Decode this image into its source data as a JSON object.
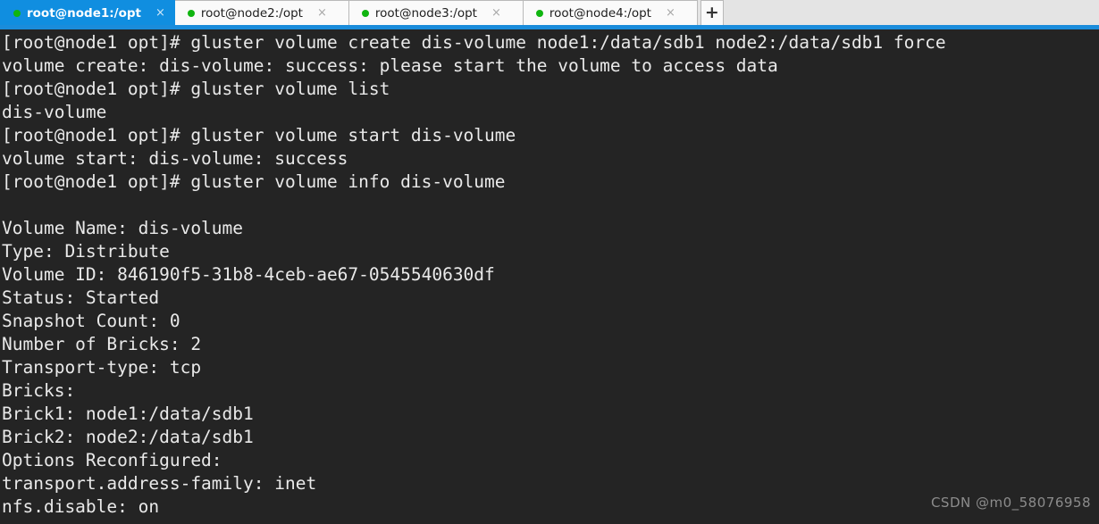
{
  "window": {
    "app": "terminal-emulator",
    "accent_color": "#108ee0",
    "tabbar_bg": "#e4e4e4",
    "terminal_bg": "#242424",
    "terminal_fg": "#e9e9e9",
    "dot_color": "#10b510"
  },
  "tabbar": {
    "tabs": [
      {
        "label": "root@node1:/opt",
        "active": true,
        "close_label": "×",
        "dot": "status-dot"
      },
      {
        "label": "root@node2:/opt",
        "active": false,
        "close_label": "×",
        "dot": "status-dot"
      },
      {
        "label": "root@node3:/opt",
        "active": false,
        "close_label": "×",
        "dot": "status-dot"
      },
      {
        "label": "root@node4:/opt",
        "active": false,
        "close_label": "×",
        "dot": "status-dot"
      }
    ],
    "new_tab_label": "+"
  },
  "terminal": {
    "prompt": "[root@node1 opt]# ",
    "lines": [
      "[root@node1 opt]# gluster volume create dis-volume node1:/data/sdb1 node2:/data/sdb1 force",
      "volume create: dis-volume: success: please start the volume to access data",
      "[root@node1 opt]# gluster volume list",
      "dis-volume",
      "[root@node1 opt]# gluster volume start dis-volume",
      "volume start: dis-volume: success",
      "[root@node1 opt]# gluster volume info dis-volume",
      "",
      "Volume Name: dis-volume",
      "Type: Distribute",
      "Volume ID: 846190f5-31b8-4ceb-ae67-0545540630df",
      "Status: Started",
      "Snapshot Count: 0",
      "Number of Bricks: 2",
      "Transport-type: tcp",
      "Bricks:",
      "Brick1: node1:/data/sdb1",
      "Brick2: node2:/data/sdb1",
      "Options Reconfigured:",
      "transport.address-family: inet",
      "nfs.disable: on"
    ]
  },
  "watermark": {
    "text": "CSDN @m0_58076958"
  }
}
